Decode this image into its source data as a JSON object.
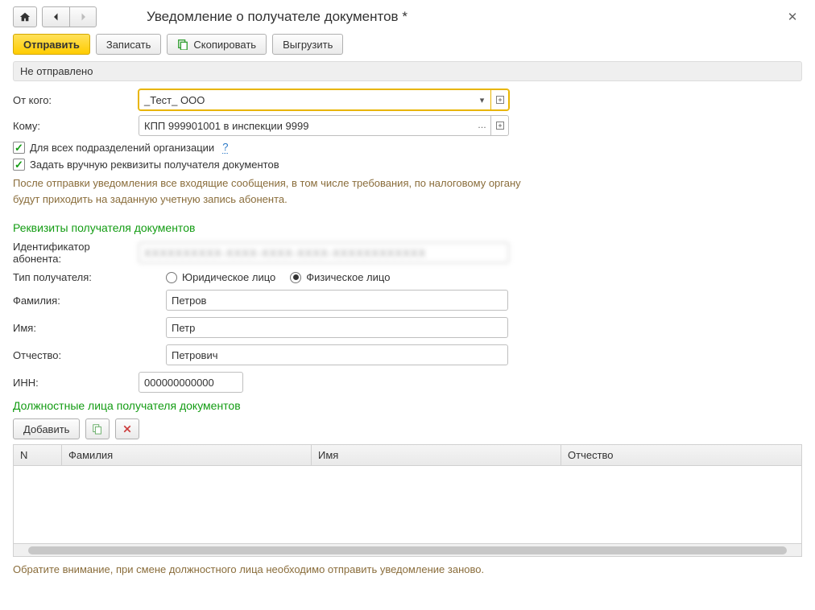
{
  "title": "Уведомление о получателе документов *",
  "toolbar": {
    "send": "Отправить",
    "save": "Записать",
    "copy": "Скопировать",
    "export": "Выгрузить"
  },
  "status": "Не отправлено",
  "form": {
    "from_label": "От кого:",
    "from_value": "_Тест_ ООО",
    "to_label": "Кому:",
    "to_value": "КПП 999901001 в инспекции 9999",
    "all_subdiv_label": "Для всех подразделений организации",
    "manual_req_label": "Задать вручную реквизиты получателя документов"
  },
  "hint": "После отправки уведомления все входящие сообщения, в том числе требования, по налоговому органу будут приходить на заданную учетную запись абонента.",
  "section1_title": "Реквизиты получателя документов",
  "recipient": {
    "id_label": "Идентификатор абонента:",
    "id_value": "XXXXXXXXXX-XXXX-XXXX-XXXX-XXXXXXXXXXXX",
    "type_label": "Тип получателя:",
    "type_legal": "Юридическое лицо",
    "type_person": "Физическое лицо",
    "surname_label": "Фамилия:",
    "surname_value": "Петров",
    "name_label": "Имя:",
    "name_value": "Петр",
    "patronymic_label": "Отчество:",
    "patronymic_value": "Петрович",
    "inn_label": "ИНН:",
    "inn_value": "000000000000"
  },
  "section2_title": "Должностные лица получателя документов",
  "table": {
    "add": "Добавить",
    "cols": {
      "n": "N",
      "surname": "Фамилия",
      "name": "Имя",
      "patronymic": "Отчество"
    }
  },
  "footer_note": "Обратите внимание, при смене должностного лица необходимо отправить уведомление заново.",
  "help_q": "?"
}
